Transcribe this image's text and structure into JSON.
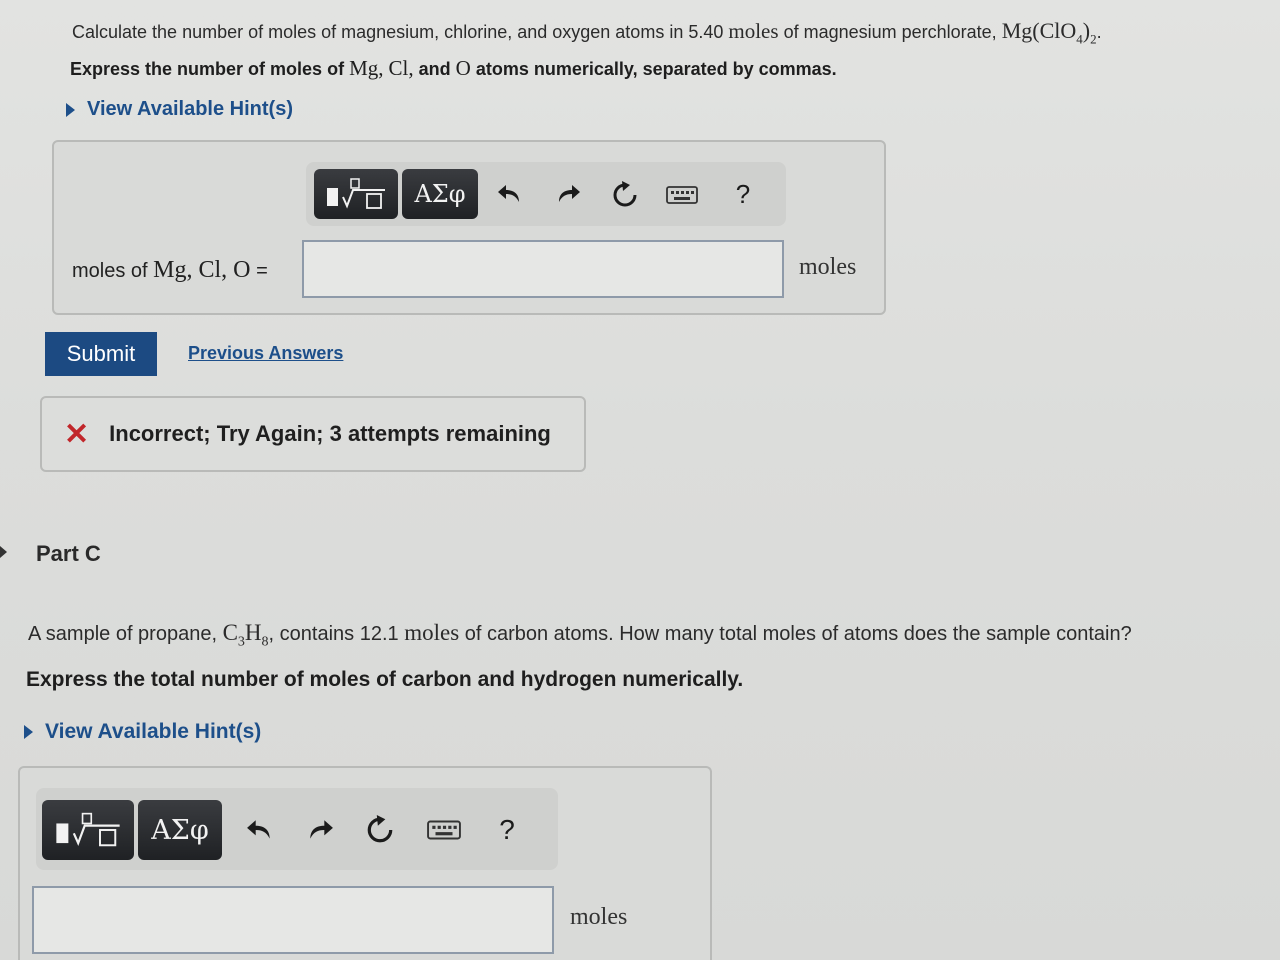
{
  "part_b": {
    "question_prefix": "Calculate the number of moles of magnesium, chlorine, and oxygen atoms in 5.40",
    "question_unit": "moles",
    "question_middle": "of magnesium perchlorate,",
    "formula_main": "Mg(ClO",
    "formula_sub_4": "4",
    "formula_close": ")",
    "formula_sub_2": "2",
    "instruction_prefix": "Express the number of moles of",
    "inst_mg": "Mg,",
    "inst_cl": "Cl,",
    "inst_and": "and",
    "inst_o": "O",
    "instruction_suffix": "atoms numerically, separated by commas.",
    "hint_label": "View Available Hint(s)",
    "label_prefix": "moles of",
    "label_symbols": "Mg,  Cl,  O",
    "label_equals": "=",
    "units": "moles",
    "input_value": "",
    "submit_label": "Submit",
    "previous_answers_label": "Previous Answers",
    "feedback_icon": "✕",
    "feedback_text": "Incorrect; Try Again; 3 attempts remaining"
  },
  "toolbar": {
    "greek_label": "ΑΣφ",
    "help_label": "?",
    "icons": [
      "templates-icon",
      "undo-icon",
      "redo-icon",
      "reset-icon",
      "keyboard-icon",
      "help-icon"
    ]
  },
  "part_c": {
    "title": "Part C",
    "question_prefix": "A sample of propane,",
    "formula_c": "C",
    "formula_sub_3": "3",
    "formula_h": "H",
    "formula_sub_8": "8",
    "question_middle": ", contains 12.1",
    "question_unit": "moles",
    "question_suffix": "of carbon atoms. How many total moles of atoms does the sample contain?",
    "instruction": "Express the total number of moles of carbon and hydrogen numerically.",
    "hint_label": "View Available Hint(s)",
    "units": "moles",
    "input_value": ""
  },
  "colors": {
    "accent": "#1d4f8a",
    "submit_bg": "#1c4a82",
    "error": "#c1262a"
  }
}
